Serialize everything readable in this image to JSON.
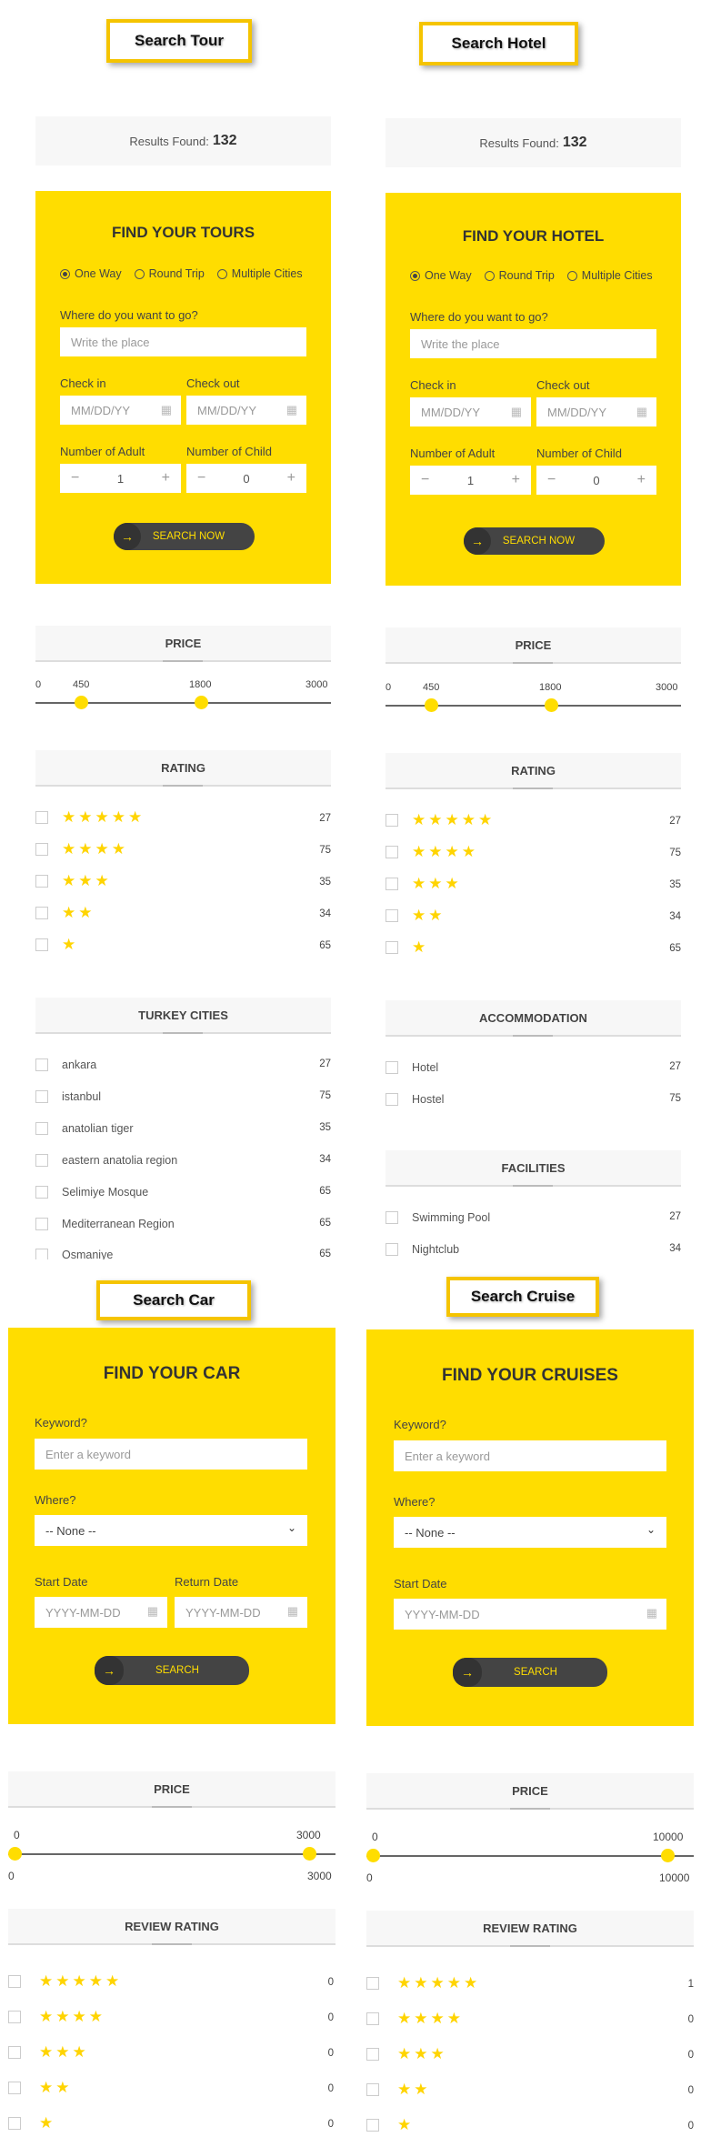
{
  "badges": {
    "tour": "Search Tour",
    "hotel": "Search Hotel",
    "car": "Search Car",
    "cruise": "Search Cruise"
  },
  "results": {
    "label": "Results Found:",
    "count": "132"
  },
  "tour": {
    "title": "FIND YOUR TOURS",
    "radios": [
      "One Way",
      "Round Trip",
      "Multiple Cities"
    ],
    "where_label": "Where do you want to go?",
    "where_placeholder": "Write the place",
    "checkin_label": "Check in",
    "checkout_label": "Check out",
    "date_placeholder": "MM/DD/YY",
    "adult_label": "Number of Adult",
    "child_label": "Number of Child",
    "adult_value": "1",
    "child_value": "0",
    "button": "SEARCH NOW"
  },
  "hotel": {
    "title": "FIND YOUR HOTEL",
    "radios": [
      "One Way",
      "Round Trip",
      "Multiple Cities"
    ],
    "where_label": "Where do you want to go?",
    "where_placeholder": "Write the place",
    "checkin_label": "Check in",
    "checkout_label": "Check out",
    "date_placeholder": "MM/DD/YY",
    "adult_label": "Number of Adult",
    "child_label": "Number of Child",
    "adult_value": "1",
    "child_value": "0",
    "button": "SEARCH NOW"
  },
  "price_small": {
    "title": "PRICE",
    "min": "0",
    "low": "450",
    "high": "1800",
    "max": "3000",
    "low_frac": 0.15,
    "high_frac": 0.6
  },
  "rating": {
    "title": "RATING",
    "rows": [
      {
        "stars": "★★★★★",
        "count": "27"
      },
      {
        "stars": "★★★★",
        "count": "75"
      },
      {
        "stars": "★★★",
        "count": "35"
      },
      {
        "stars": "★★",
        "count": "34"
      },
      {
        "stars": "★",
        "count": "65"
      }
    ]
  },
  "turkey": {
    "title": "TURKEY CITIES",
    "rows": [
      {
        "name": "ankara",
        "count": "27"
      },
      {
        "name": "istanbul",
        "count": "75"
      },
      {
        "name": "anatolian tiger",
        "count": "35"
      },
      {
        "name": "eastern anatolia region",
        "count": "34"
      },
      {
        "name": "Selimiye Mosque",
        "count": "65"
      },
      {
        "name": "Mediterranean Region",
        "count": "65"
      },
      {
        "name": "Osmaniye",
        "count": "65"
      }
    ]
  },
  "accommodation": {
    "title": "ACCOMMODATION",
    "rows": [
      {
        "name": "Hotel",
        "count": "27"
      },
      {
        "name": "Hostel",
        "count": "75"
      }
    ]
  },
  "facilities": {
    "title": "FACILITIES",
    "rows": [
      {
        "name": "Swimming Pool",
        "count": "27"
      },
      {
        "name": "Nightclub",
        "count": "34"
      }
    ]
  },
  "car": {
    "title": "FIND YOUR CAR",
    "keyword_label": "Keyword?",
    "keyword_placeholder": "Enter a keyword",
    "where_label": "Where?",
    "where_value": "-- None --",
    "start_label": "Start Date",
    "return_label": "Return Date",
    "date_placeholder": "YYYY-MM-DD",
    "button": "SEARCH"
  },
  "cruise": {
    "title": "FIND YOUR CRUISES",
    "keyword_label": "Keyword?",
    "keyword_placeholder": "Enter a keyword",
    "where_label": "Where?",
    "where_value": "-- None --",
    "start_label": "Start Date",
    "date_placeholder": "YYYY-MM-DD",
    "button": "SEARCH"
  },
  "car_price": {
    "title": "PRICE",
    "top_min": "0",
    "top_max": "3000",
    "bot_min": "0",
    "bot_max": "3000"
  },
  "cruise_price": {
    "title": "PRICE",
    "top_min": "0",
    "top_max": "10000",
    "bot_min": "0",
    "bot_max": "10000"
  },
  "car_review": {
    "title": "REVIEW RATING",
    "rows": [
      {
        "stars": "★★★★★",
        "count": "0"
      },
      {
        "stars": "★★★★",
        "count": "0"
      },
      {
        "stars": "★★★",
        "count": "0"
      },
      {
        "stars": "★★",
        "count": "0"
      },
      {
        "stars": "★",
        "count": "0"
      }
    ]
  },
  "cruise_review": {
    "title": "REVIEW RATING",
    "rows": [
      {
        "stars": "★★★★★",
        "count": "1"
      },
      {
        "stars": "★★★★",
        "count": "0"
      },
      {
        "stars": "★★★",
        "count": "0"
      },
      {
        "stars": "★★",
        "count": "0"
      },
      {
        "stars": "★",
        "count": "0"
      }
    ]
  },
  "colors": {
    "accent": "#ffdd00",
    "dark": "#444444",
    "badge_border": "#f5c400"
  }
}
